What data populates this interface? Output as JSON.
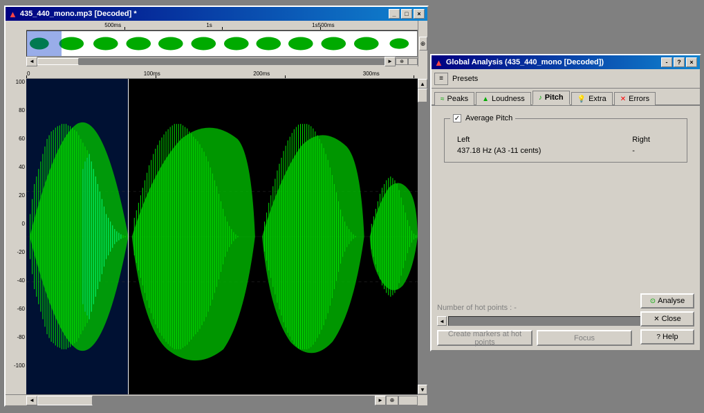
{
  "waveform_window": {
    "title": "435_440_mono.mp3 [Decoded] *",
    "controls": [
      "_",
      "□",
      "×"
    ]
  },
  "top_ruler": {
    "labels": [
      "500ms",
      "1s",
      "1s500ms"
    ]
  },
  "main_ruler": {
    "labels": [
      "0",
      "100ms",
      "200ms",
      "300ms"
    ]
  },
  "y_axis": {
    "labels": [
      "100",
      "80",
      "60",
      "40",
      "20",
      "0",
      "-20",
      "-40",
      "-60",
      "-80",
      "-100"
    ]
  },
  "analysis_window": {
    "title": "Global Analysis (435_440_mono [Decoded])",
    "controls": [
      "-",
      "?",
      "×"
    ]
  },
  "presets": {
    "label": "Presets"
  },
  "tabs": [
    {
      "id": "peaks",
      "label": "Peaks",
      "icon": "≈"
    },
    {
      "id": "loudness",
      "label": "Loudness",
      "icon": "▲"
    },
    {
      "id": "pitch",
      "label": "Pitch",
      "icon": "♪",
      "active": true
    },
    {
      "id": "extra",
      "label": "Extra",
      "icon": "💡"
    },
    {
      "id": "errors",
      "label": "Errors",
      "icon": "×"
    }
  ],
  "pitch_tab": {
    "group_title": "Average Pitch",
    "checkbox_checked": true,
    "col_left": "Left",
    "col_right": "Right",
    "left_value": "437.18 Hz (A3 -11 cents)",
    "right_value": "-"
  },
  "bottom_controls": {
    "hot_points_label": "Number of hot points : -",
    "create_markers_label": "Create markers at hot points",
    "focus_label": "Focus"
  },
  "right_buttons": {
    "analyse_label": "Analyse",
    "close_label": "Close",
    "help_label": "Help"
  }
}
